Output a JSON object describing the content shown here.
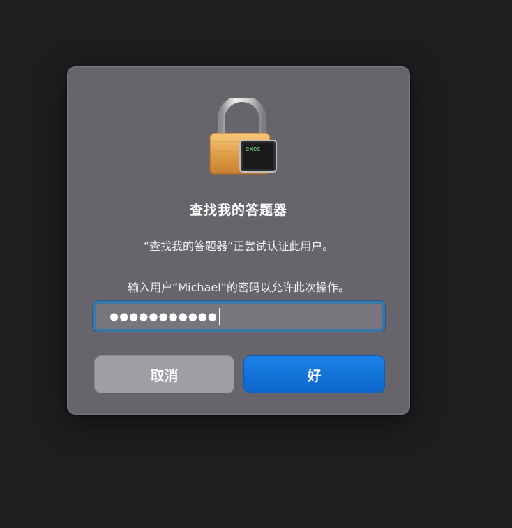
{
  "dialog": {
    "icon": "padlock-with-terminal-icon",
    "terminal_text": "exec",
    "title": "查找我的答题器",
    "subtitle": "“查找我的答题器”正尝试认证此用户。",
    "prompt": "输入用户“Michael”的密码以允许此次操作。",
    "password": {
      "masked_value": "●●●●●●●●●●●"
    },
    "buttons": {
      "cancel_label": "取消",
      "ok_label": "好"
    }
  },
  "colors": {
    "accent": "#0b6fd8",
    "focus_ring": "#3a76a8",
    "dialog_bg": "#67646b",
    "desktop_bg": "#1d1e20"
  }
}
